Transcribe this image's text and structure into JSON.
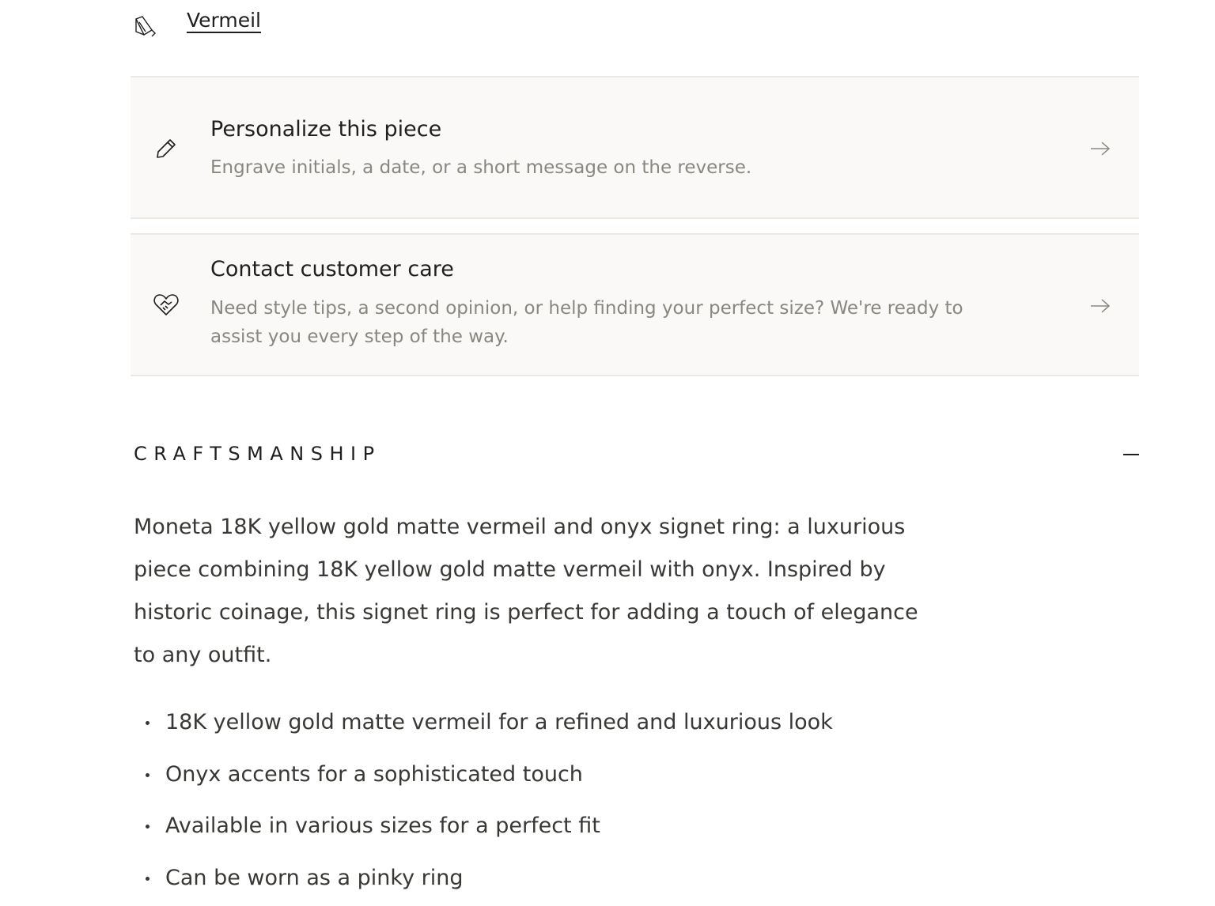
{
  "material": {
    "icon": "bucket-paint-icon",
    "label": "Vermeil"
  },
  "cards": {
    "personalize": {
      "icon": "pencil-icon",
      "title": "Personalize this piece",
      "description": "Engrave initials, a date, or a short message on the reverse.",
      "arrow_icon": "arrow-right-icon"
    },
    "contact": {
      "icon": "heart-handshake-icon",
      "title": "Contact customer care",
      "description": "Need style tips, a second opinion, or help finding your perfect size? We're ready to assist you every step of the way.",
      "arrow_icon": "arrow-right-icon"
    }
  },
  "craftsmanship": {
    "title": "CRAFTSMANSHIP",
    "toggle_icon": "minus-icon",
    "description": "Moneta 18K yellow gold matte vermeil and onyx signet ring: a luxurious piece combining 18K yellow gold matte vermeil with onyx. Inspired by historic coinage, this signet ring is perfect for adding a touch of elegance to any outfit.",
    "features": [
      "18K yellow gold matte vermeil for a refined and luxurious look",
      "Onyx accents for a sophisticated touch",
      "Available in various sizes for a perfect fit",
      "Can be worn as a pinky ring"
    ]
  },
  "colors": {
    "card_background": "#faf9f7",
    "text_primary": "#1f1f1f",
    "text_muted": "#8a8780"
  }
}
